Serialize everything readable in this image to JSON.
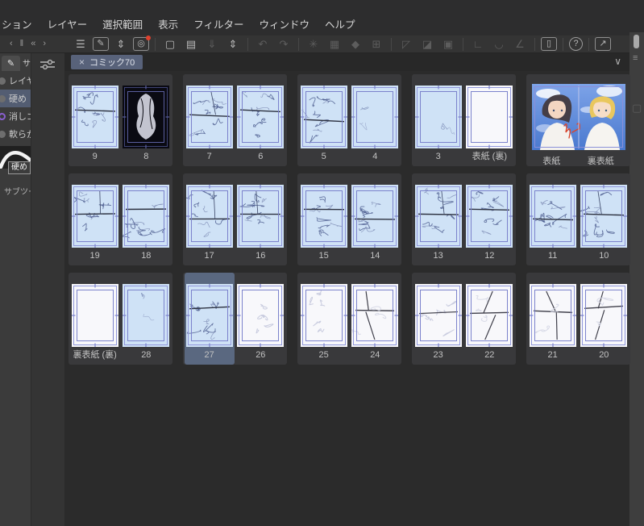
{
  "menubar": {
    "items": [
      "ション",
      "レイヤー",
      "選択範囲",
      "表示",
      "フィルター",
      "ウィンドウ",
      "ヘルプ"
    ]
  },
  "toolbar": {
    "dock_arrows": [
      {
        "name": "dock-prev-arrow",
        "glyph": "‹"
      },
      {
        "name": "dock-divider-handle",
        "glyph": "‖"
      },
      {
        "name": "dock-collapse-arrow",
        "glyph": "«"
      },
      {
        "name": "dock-next-arrow",
        "glyph": "›"
      }
    ],
    "groups": [
      {
        "buttons": [
          {
            "name": "main-menu-icon",
            "glyph": "☰",
            "enabled": true
          },
          {
            "name": "current-tool-icon",
            "glyph": "✎",
            "enabled": true,
            "boxed": true
          },
          {
            "name": "tool-switch-chevrons-icon",
            "glyph": "⇕",
            "enabled": true
          },
          {
            "name": "open-clip-studio-icon",
            "glyph": "◎",
            "enabled": true,
            "boxed": true,
            "badge": true
          }
        ]
      },
      {
        "buttons": [
          {
            "name": "new-file-icon",
            "glyph": "▢",
            "enabled": true
          },
          {
            "name": "open-file-icon",
            "glyph": "▤",
            "enabled": true
          },
          {
            "name": "save-file-icon",
            "glyph": "⇓",
            "enabled": false
          },
          {
            "name": "file-chevrons-icon",
            "glyph": "⇕",
            "enabled": true
          }
        ]
      },
      {
        "buttons": [
          {
            "name": "undo-icon",
            "glyph": "↶",
            "enabled": false
          },
          {
            "name": "redo-icon",
            "glyph": "↷",
            "enabled": false
          }
        ]
      },
      {
        "buttons": [
          {
            "name": "processing-icon",
            "glyph": "✳",
            "enabled": false
          },
          {
            "name": "select-from-layer-icon",
            "glyph": "▦",
            "enabled": false
          },
          {
            "name": "fill-icon",
            "glyph": "◆",
            "enabled": false
          },
          {
            "name": "crop-icon",
            "glyph": "⊞",
            "enabled": false
          }
        ]
      },
      {
        "buttons": [
          {
            "name": "deselect-icon",
            "glyph": "◸",
            "enabled": false
          },
          {
            "name": "invert-selection-icon",
            "glyph": "◪",
            "enabled": false
          },
          {
            "name": "selection-border-icon",
            "glyph": "▣",
            "enabled": false
          }
        ]
      },
      {
        "buttons": [
          {
            "name": "snap-ruler-icon",
            "glyph": "∟",
            "enabled": false
          },
          {
            "name": "snap-special-ruler-icon",
            "glyph": "◡",
            "enabled": false
          },
          {
            "name": "snap-grid-icon",
            "glyph": "∠",
            "enabled": false
          }
        ]
      },
      {
        "buttons": [
          {
            "name": "companion-mode-icon",
            "glyph": "▯",
            "enabled": true,
            "boxed": true
          }
        ]
      },
      {
        "buttons": [
          {
            "name": "help-icon",
            "glyph": "?",
            "enabled": true,
            "circled": true
          }
        ]
      },
      {
        "buttons": [
          {
            "name": "fullscreen-icon",
            "glyph": "↗",
            "enabled": true,
            "boxed": true
          }
        ]
      }
    ]
  },
  "tabbar": {
    "close_glyph": "×",
    "label": "コミック70",
    "collapse_glyph": "∨"
  },
  "sidebar": {
    "tool_tab_icon_glyph": "✎",
    "tool_tab_label": "サ",
    "subtools": [
      {
        "label": "レイヤー",
        "icon": "tool",
        "selected": false
      },
      {
        "label": "硬め",
        "icon": "tool",
        "selected": true
      },
      {
        "label": "消しゴム",
        "icon": "eraser",
        "selected": false
      },
      {
        "label": "軟らか",
        "icon": "tool",
        "selected": false
      }
    ],
    "brush_preview_label": "硬め",
    "section_caption": "サブツー"
  },
  "right_dock": {
    "menu_glyph": "≡",
    "palette_glyph": "▢"
  },
  "page_manager": {
    "rows": [
      {
        "cards": [
          {
            "type": "spread",
            "pages": [
              {
                "label": "9",
                "style": "sketch",
                "seed": 9
              },
              {
                "label": "8",
                "style": "dark",
                "seed": 8
              }
            ]
          },
          {
            "type": "spread",
            "pages": [
              {
                "label": "7",
                "style": "sketch",
                "seed": 7
              },
              {
                "label": "6",
                "style": "sketch",
                "seed": 6
              }
            ]
          },
          {
            "type": "spread",
            "pages": [
              {
                "label": "5",
                "style": "sketch",
                "seed": 5
              },
              {
                "label": "4",
                "style": "blue-light",
                "seed": 4
              }
            ]
          },
          {
            "type": "spread",
            "pages": [
              {
                "label": "3",
                "style": "blue-light",
                "seed": 3
              },
              {
                "label": "表紙 (裏)",
                "style": "white",
                "seed": 2
              }
            ]
          },
          {
            "type": "cover",
            "pages": [
              {
                "label": "表紙"
              },
              {
                "label": "裏表紙"
              }
            ]
          }
        ]
      },
      {
        "cards": [
          {
            "type": "spread",
            "pages": [
              {
                "label": "19",
                "style": "sketch",
                "seed": 19
              },
              {
                "label": "18",
                "style": "sketch",
                "seed": 18
              }
            ]
          },
          {
            "type": "spread",
            "pages": [
              {
                "label": "17",
                "style": "sketch",
                "seed": 17
              },
              {
                "label": "16",
                "style": "sketch",
                "seed": 16
              }
            ]
          },
          {
            "type": "spread",
            "pages": [
              {
                "label": "15",
                "style": "sketch",
                "seed": 15
              },
              {
                "label": "14",
                "style": "sketch",
                "seed": 14
              }
            ]
          },
          {
            "type": "spread",
            "pages": [
              {
                "label": "13",
                "style": "sketch",
                "seed": 13
              },
              {
                "label": "12",
                "style": "sketch",
                "seed": 12
              }
            ]
          },
          {
            "type": "spread",
            "pages": [
              {
                "label": "11",
                "style": "sketch",
                "seed": 11
              },
              {
                "label": "10",
                "style": "sketch",
                "seed": 10
              }
            ]
          }
        ]
      },
      {
        "cards": [
          {
            "type": "spread",
            "pages": [
              {
                "label": "裏表紙 (裏)",
                "style": "white",
                "seed": 30
              },
              {
                "label": "28",
                "style": "blue-light",
                "seed": 28
              }
            ]
          },
          {
            "type": "spread",
            "pages": [
              {
                "label": "27",
                "style": "sketch",
                "seed": 27,
                "selected": true
              },
              {
                "label": "26",
                "style": "white-sketch",
                "seed": 26
              }
            ]
          },
          {
            "type": "spread",
            "pages": [
              {
                "label": "25",
                "style": "white-sketch",
                "seed": 25
              },
              {
                "label": "24",
                "style": "white-panels",
                "seed": 24
              }
            ]
          },
          {
            "type": "spread",
            "pages": [
              {
                "label": "23",
                "style": "white-sketch",
                "seed": 23
              },
              {
                "label": "22",
                "style": "white-panels",
                "seed": 22
              }
            ]
          },
          {
            "type": "spread",
            "pages": [
              {
                "label": "21",
                "style": "white-panels",
                "seed": 21
              },
              {
                "label": "20",
                "style": "white-panels",
                "seed": 20
              }
            ]
          }
        ]
      }
    ]
  },
  "colors": {
    "page_blue": "#cfe2f6",
    "selection_highlight": "#5a6880",
    "tab_bg": "#58627a",
    "badge_red": "#e0412e",
    "frame_guide": "#7b82cc",
    "subtool_selected": "#535d72"
  }
}
